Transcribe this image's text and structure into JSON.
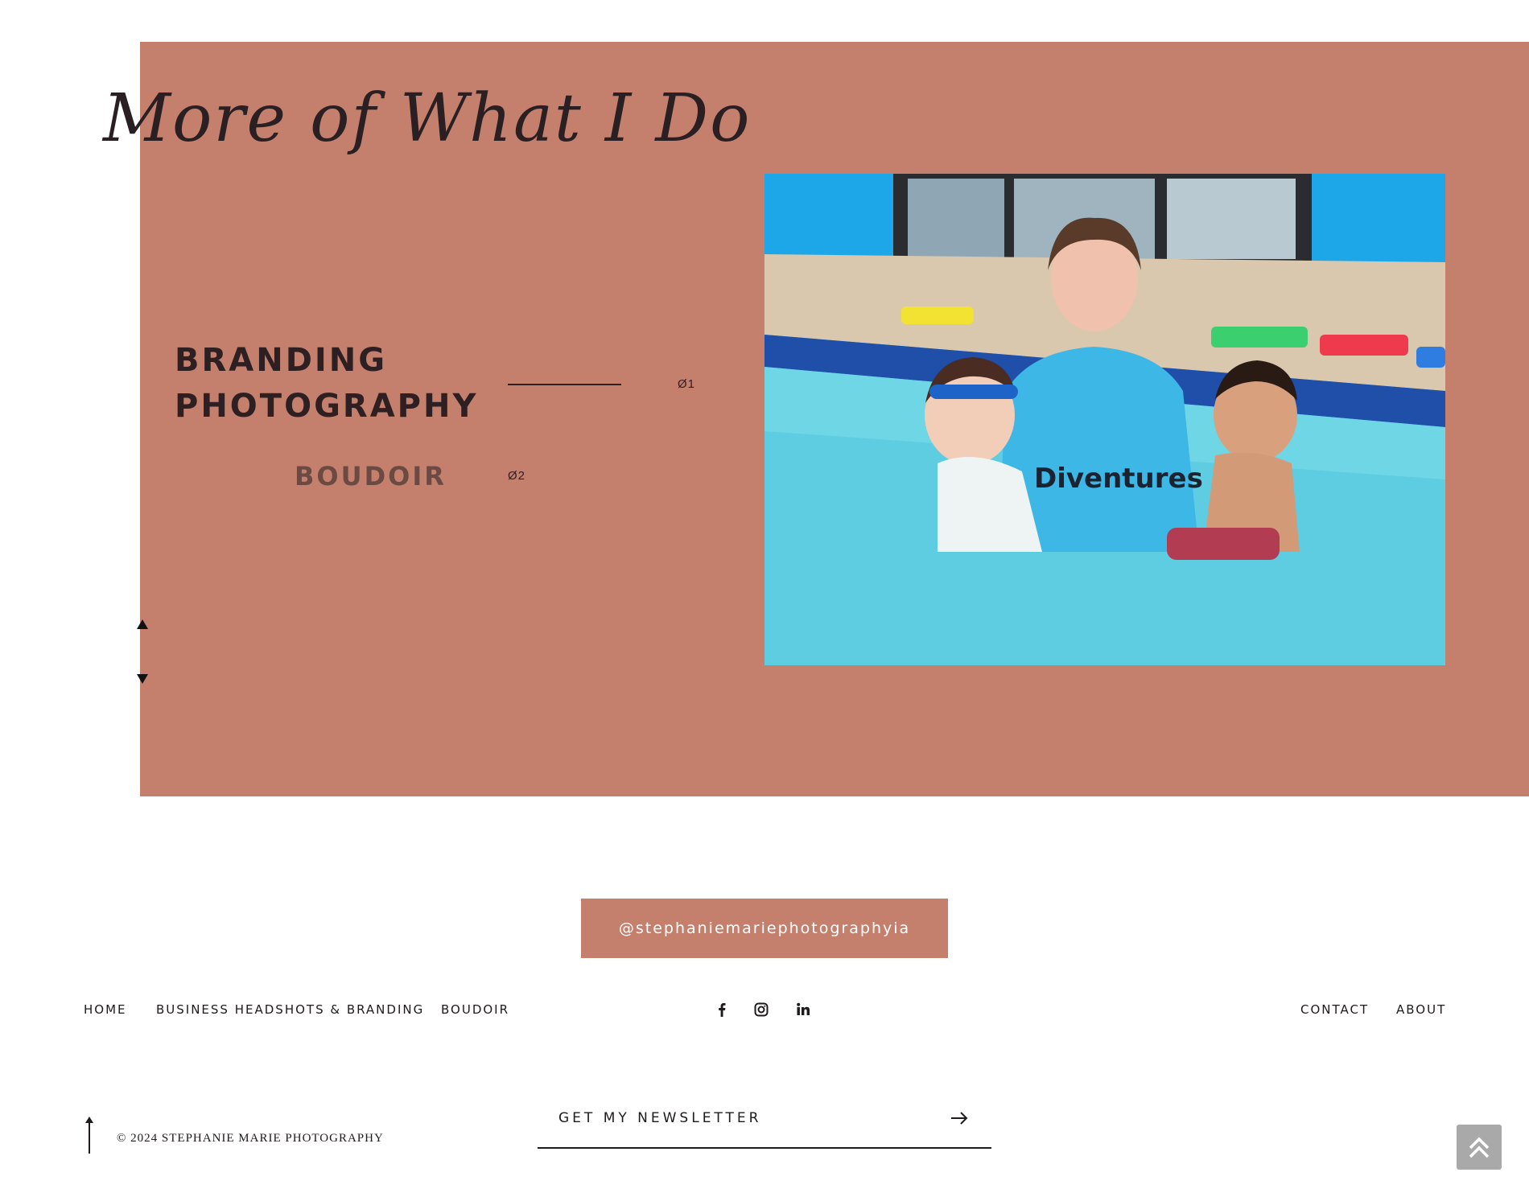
{
  "section": {
    "title": "More of What I Do",
    "services": [
      {
        "label": "BRANDING PHOTOGRAPHY",
        "number": "Ø1"
      },
      {
        "label": "BOUDOIR",
        "number": "Ø2"
      }
    ]
  },
  "instagram": {
    "handle": "@stephaniemariephotographyia"
  },
  "footer": {
    "nav_left": [
      "HOME",
      "BUSINESS HEADSHOTS & BRANDING",
      "BOUDOIR"
    ],
    "nav_right": [
      "CONTACT",
      "ABOUT"
    ],
    "social_icons": [
      "facebook-icon",
      "instagram-icon",
      "linkedin-icon"
    ],
    "copyright": "© 2024 STEPHANIE MARIE PHOTOGRAPHY",
    "newsletter_label": "GET MY NEWSLETTER"
  },
  "colors": {
    "panel": "#c4806c",
    "text_dark": "#2a1f22",
    "service_inactive": "#6c4a44",
    "scroll_top_bg": "#a9a9a9"
  }
}
